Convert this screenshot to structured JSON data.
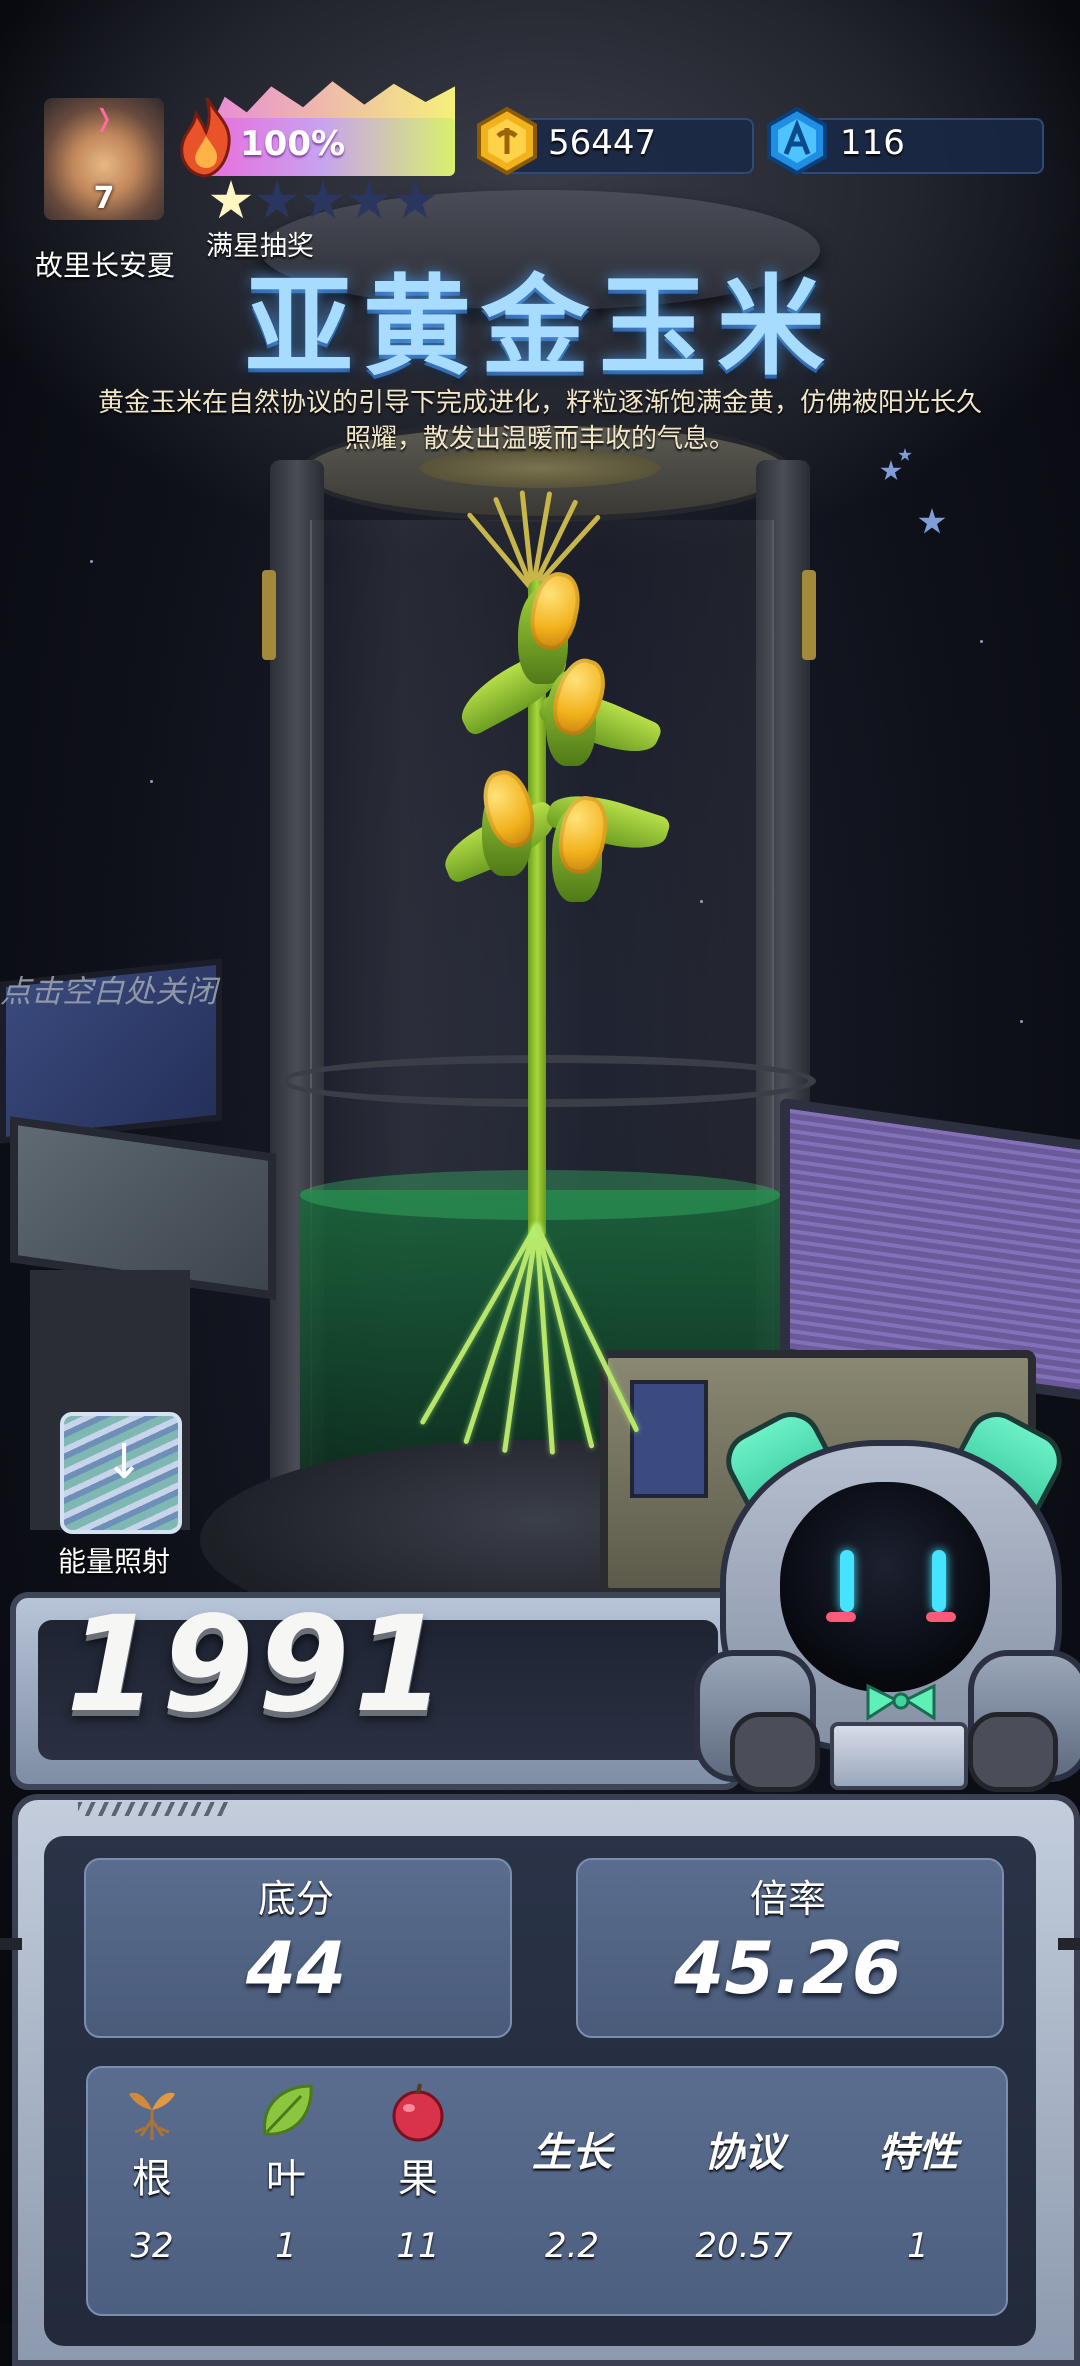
{
  "player": {
    "name": "故里长安夏",
    "level": "7"
  },
  "energy": {
    "percent_label": "100%",
    "level": 1.0,
    "stars_total": 5,
    "stars_lit": 1,
    "lottery_label": "满星抽奖"
  },
  "currency": {
    "gold": "56447",
    "gems": "116"
  },
  "plant": {
    "title": "亚黄金玉米",
    "description": "黄金玉米在自然协议的引导下完成进化，籽粒逐渐饱满金黄，仿佛被阳光长久照耀，散发出温暖而丰收的气息。"
  },
  "close_hint": "点击空白处关闭",
  "irradiate_label": "能量照射",
  "score": {
    "total": "1991",
    "base_label": "底分",
    "base_value": "44",
    "multiplier_label": "倍率",
    "multiplier_value": "45.26"
  },
  "attributes": [
    {
      "icon": "root-sprout-icon",
      "label": "根",
      "value": "32"
    },
    {
      "icon": "leaf-icon",
      "label": "叶",
      "value": "1"
    },
    {
      "icon": "apple-icon",
      "label": "果",
      "value": "11"
    },
    {
      "icon": "",
      "label": "生长",
      "value": "2.2"
    },
    {
      "icon": "",
      "label": "协议",
      "value": "20.57"
    },
    {
      "icon": "",
      "label": "特性",
      "value": "1"
    }
  ],
  "colors": {
    "title_glow": "#a8dcff",
    "liquid": "#1b6a3d",
    "robot_accent": "#6cf0c6"
  }
}
